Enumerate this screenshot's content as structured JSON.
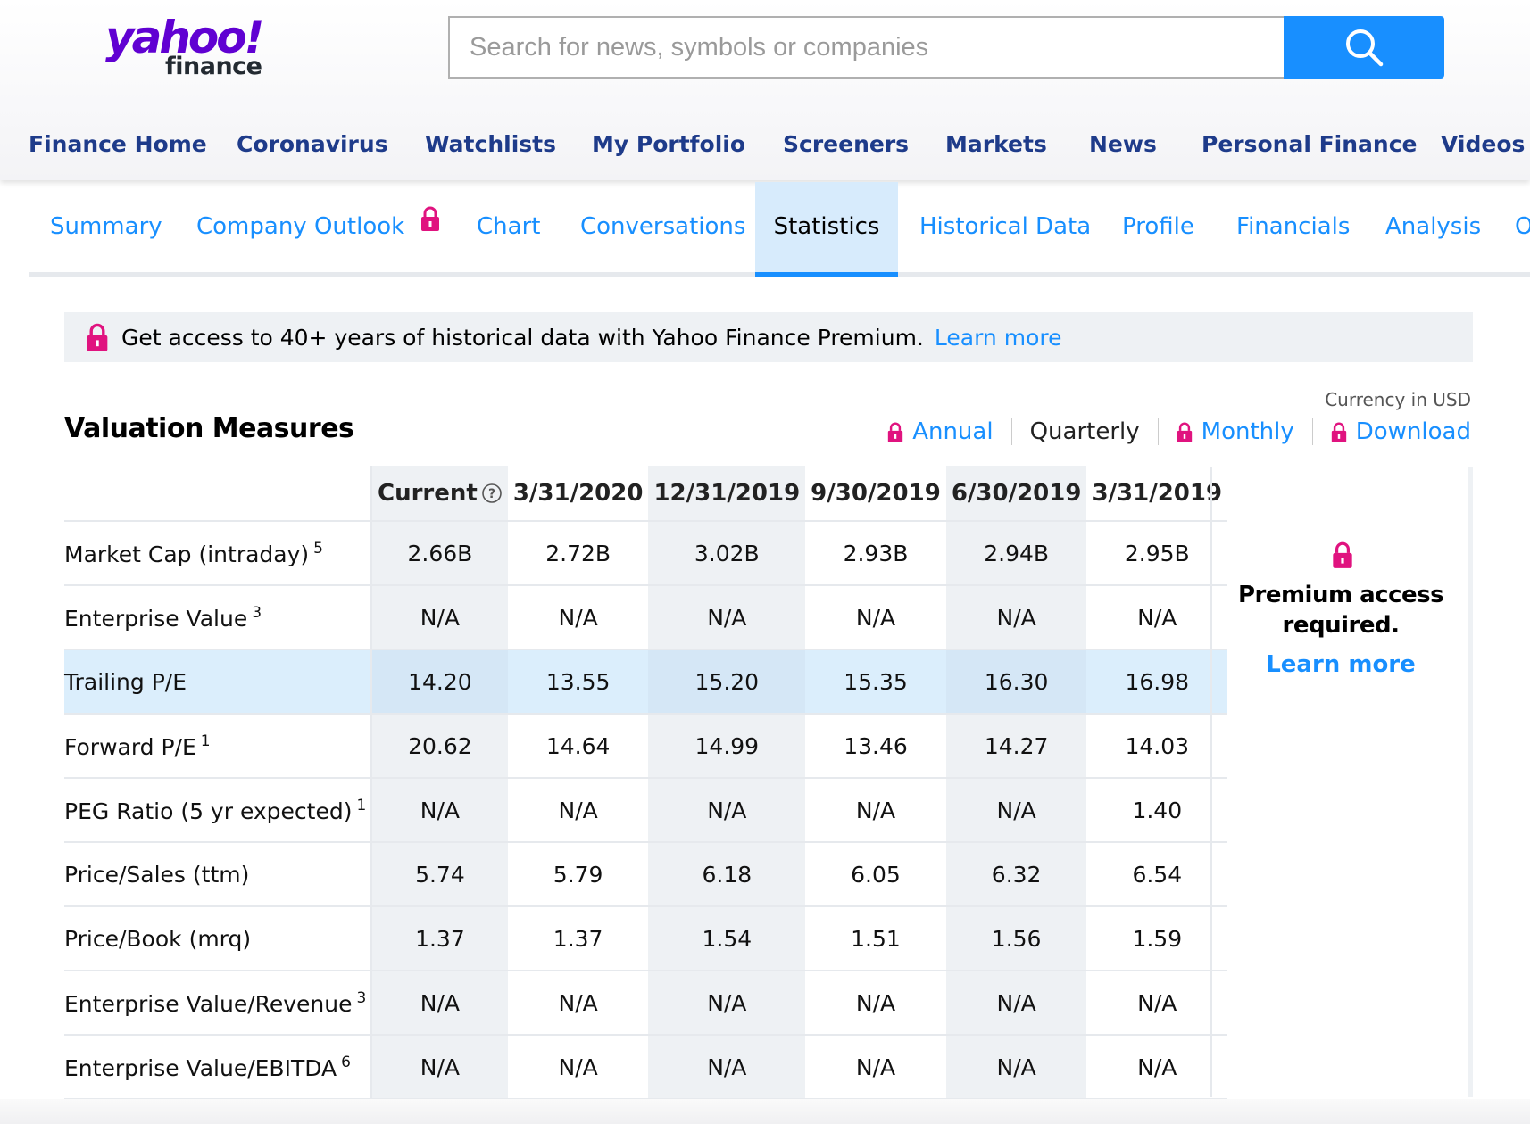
{
  "brand": {
    "logo_primary": "yahoo!",
    "logo_secondary": "finance",
    "color": "#6001d2"
  },
  "search": {
    "placeholder": "Search for news, symbols or companies",
    "value": "",
    "button_icon": "search-icon",
    "button_color": "#188fff"
  },
  "main_nav": [
    {
      "label": "Finance Home"
    },
    {
      "label": "Coronavirus"
    },
    {
      "label": "Watchlists"
    },
    {
      "label": "My Portfolio"
    },
    {
      "label": "Screeners"
    },
    {
      "label": "Markets"
    },
    {
      "label": "News"
    },
    {
      "label": "Personal Finance"
    },
    {
      "label": "Videos"
    }
  ],
  "sub_tabs": [
    {
      "label": "Summary",
      "active": false
    },
    {
      "label": "Company Outlook",
      "active": false,
      "locked": true
    },
    {
      "label": "Chart",
      "active": false
    },
    {
      "label": "Conversations",
      "active": false
    },
    {
      "label": "Statistics",
      "active": true
    },
    {
      "label": "Historical Data",
      "active": false
    },
    {
      "label": "Profile",
      "active": false
    },
    {
      "label": "Financials",
      "active": false
    },
    {
      "label": "Analysis",
      "active": false
    },
    {
      "label": "O",
      "active": false
    }
  ],
  "banner": {
    "text": "Get access to 40+ years of historical data with Yahoo Finance Premium.",
    "link": "Learn more",
    "icon": "lock-icon"
  },
  "valuation": {
    "title": "Valuation Measures",
    "currency_note": "Currency in USD",
    "periods": [
      {
        "label": "Annual",
        "locked": true
      },
      {
        "label": "Quarterly",
        "locked": false
      },
      {
        "label": "Monthly",
        "locked": true
      },
      {
        "label": "Download",
        "locked": true
      }
    ],
    "columns": [
      "Current",
      "3/31/2020",
      "12/31/2019",
      "9/30/2019",
      "6/30/2019",
      "3/31/2019"
    ],
    "rows": [
      {
        "label": "Market Cap (intraday)",
        "note": "5",
        "values": [
          "2.66B",
          "2.72B",
          "3.02B",
          "2.93B",
          "2.94B",
          "2.95B"
        ]
      },
      {
        "label": "Enterprise Value",
        "note": "3",
        "values": [
          "N/A",
          "N/A",
          "N/A",
          "N/A",
          "N/A",
          "N/A"
        ]
      },
      {
        "label": "Trailing P/E",
        "note": "",
        "values": [
          "14.20",
          "13.55",
          "15.20",
          "15.35",
          "16.30",
          "16.98"
        ]
      },
      {
        "label": "Forward P/E",
        "note": "1",
        "values": [
          "20.62",
          "14.64",
          "14.99",
          "13.46",
          "14.27",
          "14.03"
        ]
      },
      {
        "label": "PEG Ratio (5 yr expected)",
        "note": "1",
        "values": [
          "N/A",
          "N/A",
          "N/A",
          "N/A",
          "N/A",
          "1.40"
        ]
      },
      {
        "label": "Price/Sales (ttm)",
        "note": "",
        "values": [
          "5.74",
          "5.79",
          "6.18",
          "6.05",
          "6.32",
          "6.54"
        ]
      },
      {
        "label": "Price/Book (mrq)",
        "note": "",
        "values": [
          "1.37",
          "1.37",
          "1.54",
          "1.51",
          "1.56",
          "1.59"
        ]
      },
      {
        "label": "Enterprise Value/Revenue",
        "note": "3",
        "values": [
          "N/A",
          "N/A",
          "N/A",
          "N/A",
          "N/A",
          "N/A"
        ]
      },
      {
        "label": "Enterprise Value/EBITDA",
        "note": "6",
        "values": [
          "N/A",
          "N/A",
          "N/A",
          "N/A",
          "N/A",
          "N/A"
        ]
      }
    ],
    "highlighted_row": "Trailing P/E"
  },
  "premium_panel": {
    "text": "Premium access required.",
    "link": "Learn more",
    "icon": "lock-icon"
  },
  "colors": {
    "link": "#188fff",
    "nav": "#1e3b8a",
    "lock": "#e0137f",
    "active_tab_bg": "#d7ebfc",
    "shade": "#eef1f4"
  }
}
